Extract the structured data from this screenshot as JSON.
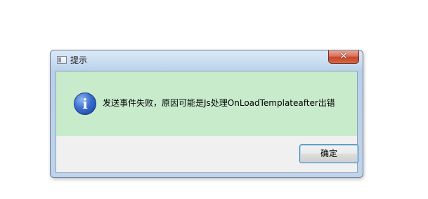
{
  "window": {
    "title": "提示",
    "close_glyph": "✕",
    "icon": "app-window-icon"
  },
  "message": {
    "icon": "info-icon",
    "icon_glyph": "i",
    "text": "发送事件失败，原因可能是Js处理OnLoadTemplateafter出错",
    "background_color": "#c8ebcb"
  },
  "buttons": {
    "ok_label": "确定"
  }
}
